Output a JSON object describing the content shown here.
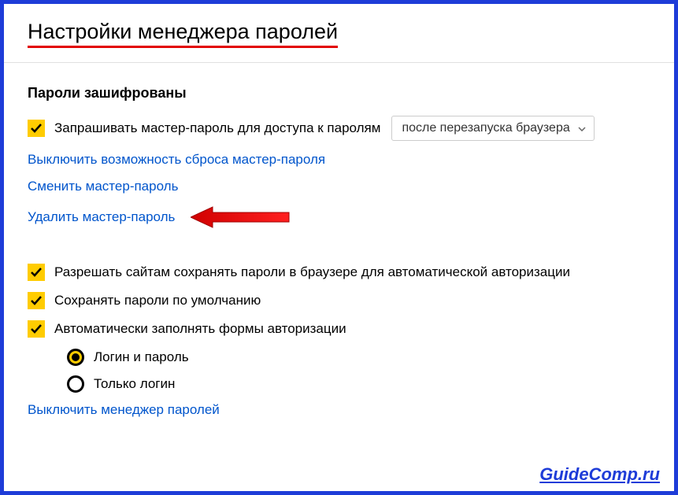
{
  "title": "Настройки менеджера паролей",
  "section1": {
    "heading": "Пароли зашифрованы",
    "checkbox1_label": "Запрашивать мастер-пароль для доступа к паролям",
    "dropdown_value": "после перезапуска браузера",
    "link_disable_reset": "Выключить возможность сброса мастер-пароля",
    "link_change_master": "Сменить мастер-пароль",
    "link_delete_master": "Удалить мастер-пароль"
  },
  "section2": {
    "checkbox_allow_sites": "Разрешать сайтам сохранять пароли в браузере для автоматической авторизации",
    "checkbox_save_default": "Сохранять пароли по умолчанию",
    "checkbox_autofill": "Автоматически заполнять формы авторизации",
    "radio_login_password": "Логин и пароль",
    "radio_login_only": "Только логин"
  },
  "link_disable_manager": "Выключить менеджер паролей",
  "watermark": "GuideComp.ru"
}
